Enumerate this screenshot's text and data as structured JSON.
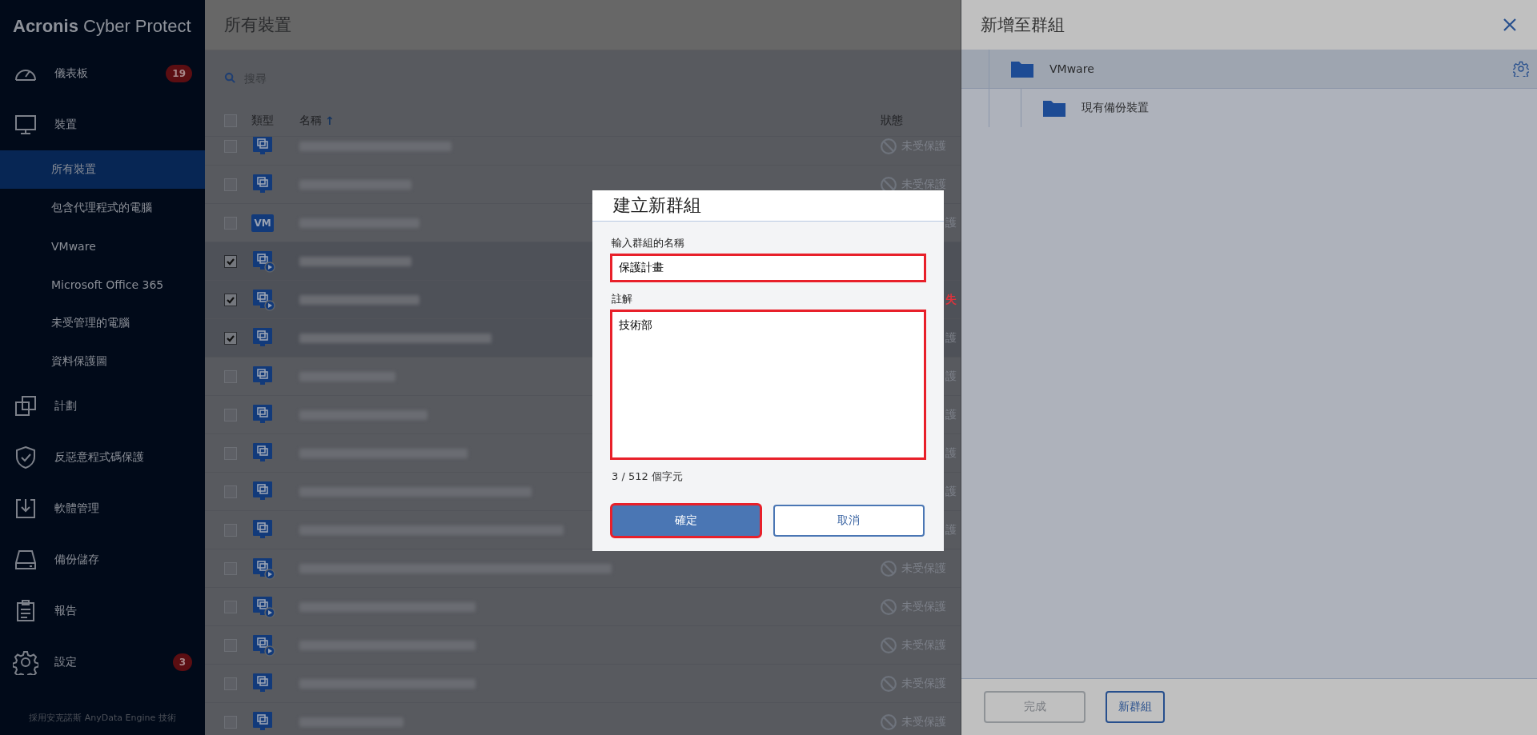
{
  "sidebar": {
    "logo": {
      "brand": "Acronis",
      "product": "Cyber Protect"
    },
    "items": [
      {
        "label": "儀表板",
        "badge": "19",
        "selected": false
      },
      {
        "label": "裝置",
        "selected": false,
        "children": [
          {
            "label": "所有裝置",
            "selected": true
          },
          {
            "label": "包含代理程式的電腦",
            "selected": false
          },
          {
            "label": "VMware",
            "selected": false
          },
          {
            "label": "Microsoft Office 365",
            "selected": false
          },
          {
            "label": "未受管理的電腦",
            "selected": false
          },
          {
            "label": "資料保護圖",
            "selected": false
          }
        ]
      },
      {
        "label": "計劃",
        "selected": false
      },
      {
        "label": "反惡意程式碼保護",
        "selected": false
      },
      {
        "label": "軟體管理",
        "selected": false
      },
      {
        "label": "備份儲存",
        "selected": false
      },
      {
        "label": "報告",
        "selected": false
      },
      {
        "label": "設定",
        "badge": "3",
        "selected": false
      }
    ],
    "footer": "採用安克諾斯 AnyData Engine 技術"
  },
  "page": {
    "title": "所有裝置",
    "search": {
      "placeholder": "搜尋"
    }
  },
  "table": {
    "columns": [
      "類型",
      "名稱",
      "狀態"
    ],
    "sort_arrow": "↑",
    "select_all_checked": false,
    "rows": [
      {
        "kind": "machine",
        "selected": false,
        "status": "未受保護"
      },
      {
        "kind": "machine",
        "selected": false,
        "status": "未受保護"
      },
      {
        "kind": "vm",
        "vm_label": "VM",
        "selected": false,
        "status_tail": "護",
        "error": false
      },
      {
        "kind": "agent",
        "selected": true
      },
      {
        "kind": "agent",
        "selected": true,
        "status_tail": "失",
        "error": true
      },
      {
        "kind": "machine",
        "selected": true,
        "status_tail": "護",
        "error": false
      },
      {
        "kind": "machine",
        "selected": false,
        "status_tail": "護",
        "error": false
      },
      {
        "kind": "machine",
        "selected": false,
        "status_tail": "護",
        "error": false
      },
      {
        "kind": "machine",
        "selected": false,
        "status_tail": "護",
        "error": false
      },
      {
        "kind": "machine",
        "selected": false,
        "status_tail": "護",
        "error": false
      },
      {
        "kind": "machine",
        "selected": false,
        "status_tail": "護",
        "error": false
      },
      {
        "kind": "agent",
        "selected": false,
        "status": "未受保護"
      },
      {
        "kind": "agent",
        "selected": false,
        "status": "未受保護"
      },
      {
        "kind": "agent",
        "selected": false,
        "status": "未受保護"
      },
      {
        "kind": "machine",
        "selected": false,
        "status": "未受保護"
      },
      {
        "kind": "machine",
        "selected": false,
        "status": "未受保護"
      }
    ]
  },
  "dialog": {
    "title": "建立新群組",
    "name_label": "輸入群組的名稱",
    "name_value": "保護計畫",
    "name_highlighted": true,
    "comment_label": "註解",
    "comment_value": "技術部",
    "comment_highlighted": true,
    "counter": "3 / 512 個字元",
    "buttons": [
      {
        "label": "確定",
        "kind": "primary",
        "highlighted": true
      },
      {
        "label": "取消",
        "kind": "secondary",
        "highlighted": false
      }
    ]
  },
  "panel": {
    "title": "新增至群組",
    "tree": [
      {
        "label": "VMware",
        "selected": true,
        "children": [
          {
            "label": "現有備份裝置",
            "selected": false
          }
        ]
      }
    ],
    "buttons": [
      {
        "label": "完成",
        "disabled": true
      },
      {
        "label": "新群組",
        "disabled": false
      }
    ]
  }
}
